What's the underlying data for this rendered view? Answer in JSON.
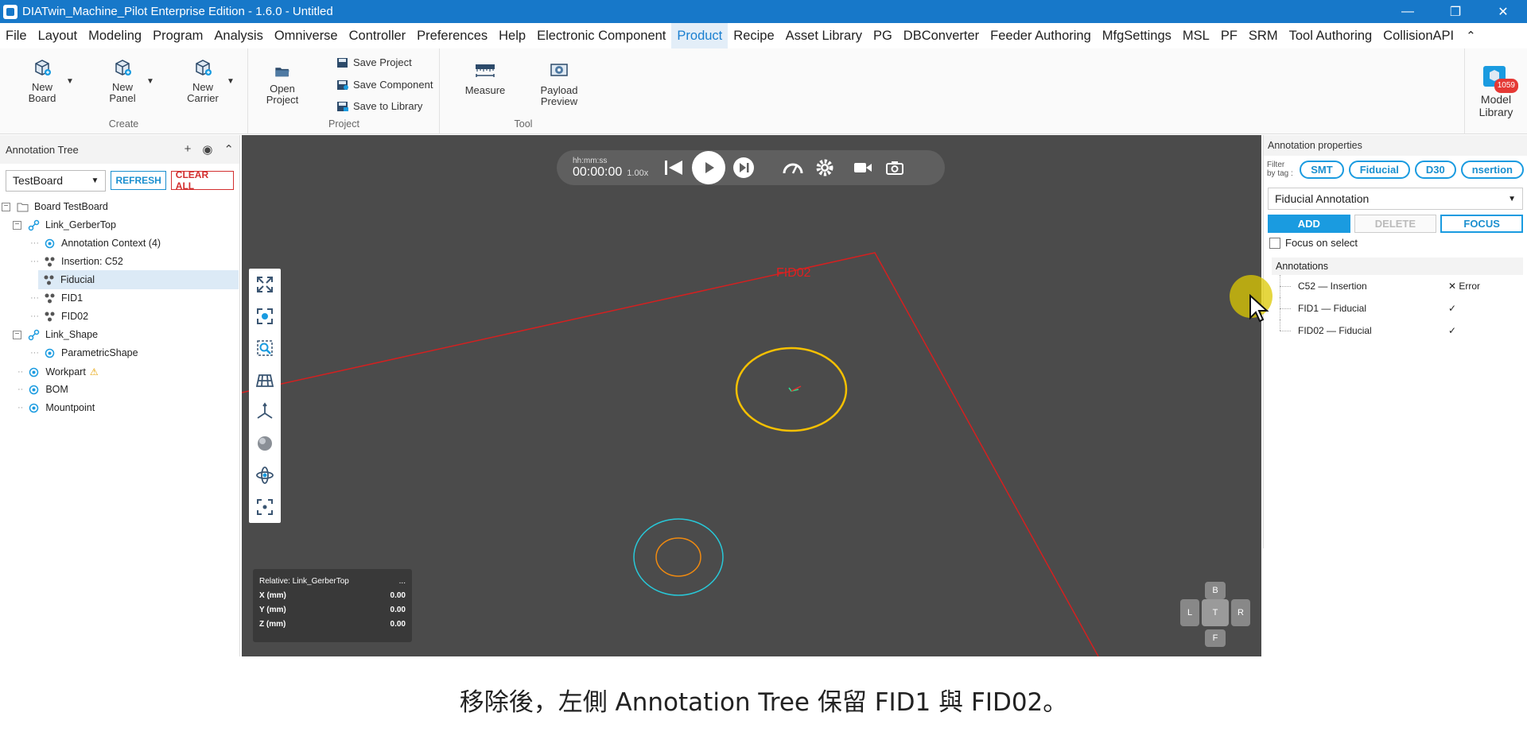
{
  "window": {
    "title": "DIATwin_Machine_Pilot Enterprise Edition - 1.6.0 - Untitled",
    "controls": [
      "minimize-icon",
      "restore-icon",
      "close-icon"
    ]
  },
  "menu": {
    "items": [
      "File",
      "Layout",
      "Modeling",
      "Program",
      "Analysis",
      "Omniverse",
      "Controller",
      "Preferences",
      "Help",
      "Electronic Component",
      "Product",
      "Recipe",
      "Asset Library",
      "PG",
      "DBConverter",
      "Feeder Authoring",
      "MfgSettings",
      "MSL",
      "PF",
      "SRM",
      "Tool Authoring",
      "CollisionAPI"
    ],
    "active": "Product"
  },
  "ribbon": {
    "create": {
      "label": "Create",
      "new_board": "New\nBoard",
      "new_panel": "New\nPanel",
      "new_carrier": "New\nCarrier"
    },
    "project": {
      "label": "Project",
      "open_project": "Open\nProject",
      "save_project": "Save Project",
      "save_component": "Save Component",
      "save_to_library": "Save to Library"
    },
    "tool": {
      "label": "Tool",
      "measure": "Measure",
      "payload_preview": "Payload\nPreview"
    },
    "model_library": {
      "label": "Model\nLibrary",
      "badge": "1059"
    }
  },
  "annotation_tree": {
    "title": "Annotation Tree",
    "board_select": "TestBoard",
    "refresh": "REFRESH",
    "clear_all": "CLEAR ALL",
    "nodes": {
      "board": "Board  TestBoard",
      "link_gerber": "Link_GerberTop",
      "ann_context": "Annotation Context (4)",
      "insertion": "Insertion: C52",
      "fiducial": "Fiducial",
      "fid1": "FID1",
      "fid02": "FID02",
      "link_shape": "Link_Shape",
      "param_shape": "ParametricShape",
      "workpart": "Workpart",
      "bom": "BOM",
      "mountpoint": "Mountpoint"
    }
  },
  "viewport": {
    "playback": {
      "time_label": "hh:mm:ss",
      "time": "00:00:00",
      "speed": "1.00x"
    },
    "fid_label": "FID02",
    "coords": {
      "relative": "Relative: Link_GerberTop",
      "more": "...",
      "x_label": "X (mm)",
      "x": "0.00",
      "y_label": "Y (mm)",
      "y": "0.00",
      "z_label": "Z (mm)",
      "z": "0.00"
    },
    "navcube": {
      "b": "B",
      "l": "L",
      "t": "T",
      "r": "R",
      "f": "F"
    },
    "colors": {
      "board_outline": "#d42020",
      "fiducial_ring": "#f5c000",
      "outer_ring": "#28c8d8",
      "inner_ring": "#f08a10"
    }
  },
  "properties": {
    "title": "Annotation properties",
    "filter_label": "Filter by tag :",
    "tags": [
      "SMT",
      "Fiducial",
      "D30",
      "nsertion"
    ],
    "type": "Fiducial Annotation",
    "add": "ADD",
    "delete": "DELETE",
    "focus": "FOCUS",
    "focus_on_select": "Focus on select",
    "annotations_label": "Annotations",
    "annotations": [
      {
        "name": "C52 — Insertion",
        "status": "✕ Error"
      },
      {
        "name": "FID1 — Fiducial",
        "status": "✓"
      },
      {
        "name": "FID02 — Fiducial",
        "status": "✓"
      }
    ]
  },
  "caption": "移除後，左側 Annotation Tree 保留 FID1 與 FID02。"
}
